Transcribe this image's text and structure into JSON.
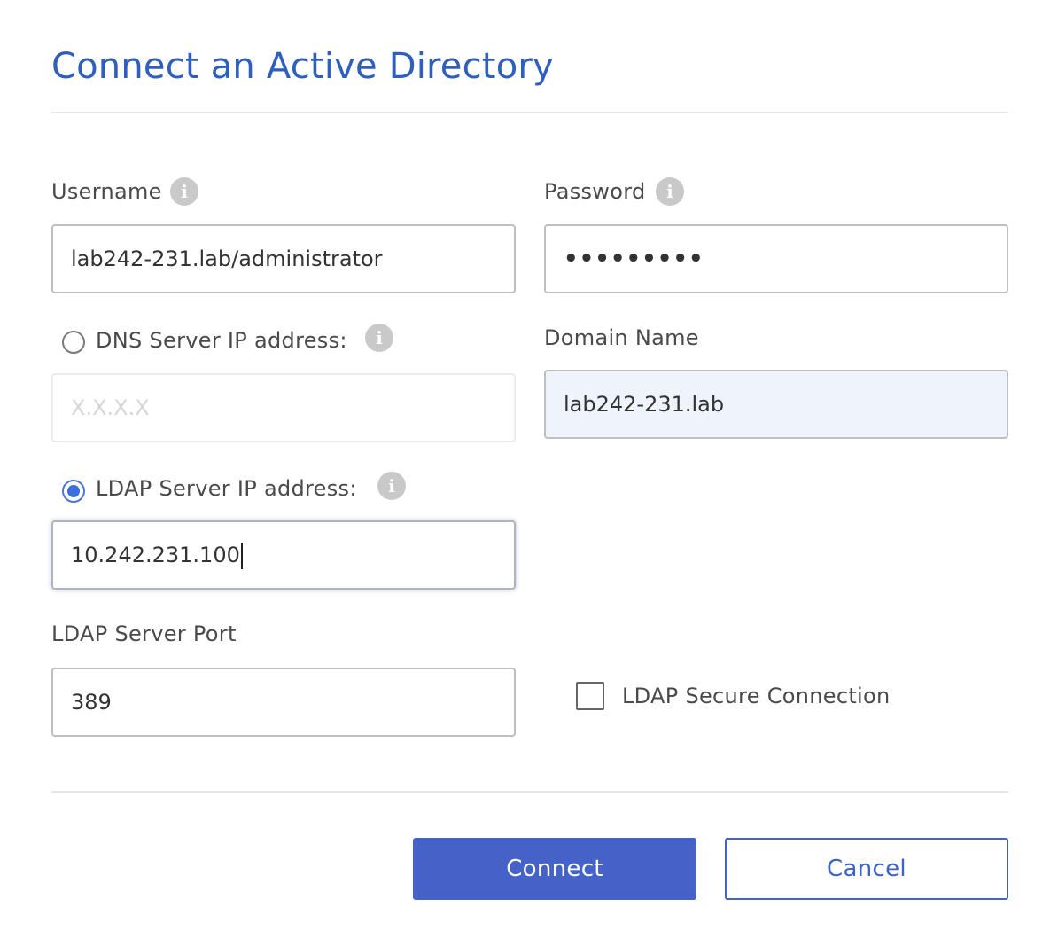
{
  "dialog": {
    "title": "Connect an Active Directory"
  },
  "username": {
    "label": "Username",
    "value": "lab242-231.lab/administrator"
  },
  "password": {
    "label": "Password",
    "masked_value": "•••••••••"
  },
  "dns_server": {
    "label": "DNS Server IP address:",
    "placeholder": "X.X.X.X",
    "selected": false
  },
  "domain_name": {
    "label": "Domain Name",
    "value": "lab242-231.lab"
  },
  "ldap_server": {
    "label": "LDAP Server IP address:",
    "value": "10.242.231.100",
    "selected": true
  },
  "ldap_port": {
    "label": "LDAP Server Port",
    "value": "389"
  },
  "ldap_secure": {
    "label": "LDAP Secure Connection",
    "checked": false
  },
  "actions": {
    "connect_label": "Connect",
    "cancel_label": "Cancel"
  },
  "colors": {
    "title": "#2f5fbe",
    "primary_button": "#4562c8",
    "radio_selected": "#3a6fde",
    "autofill_background": "#eef3fc"
  },
  "icons": {
    "info": "info-icon"
  }
}
